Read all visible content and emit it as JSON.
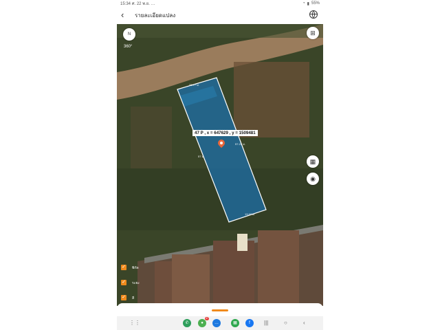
{
  "status": {
    "time": "15:34",
    "date": "ศ. 22 พ.ย.",
    "indicators": "…",
    "battery": "55%"
  },
  "header": {
    "title": "รายละเอียดแปลง"
  },
  "map": {
    "btn_360_label": "360°",
    "compass_symbol": "N",
    "parcel_label": "47 P , x = 647629 , y = 1509481",
    "dimensions": [
      "23.77 ม.",
      "57.23 ม.",
      "57 ม.",
      "13.97 ม."
    ],
    "layers": [
      {
        "label": "พิกัด",
        "checked": true
      },
      {
        "label": "ระยะ",
        "checked": true
      },
      {
        "label": "สี",
        "checked": true
      }
    ],
    "parcel_color": "#1e6fa8",
    "accent_color": "#f08a1c"
  },
  "nav": {
    "apps": [
      {
        "name": "phone-app",
        "color": "#2e9e5b"
      },
      {
        "name": "messages-app",
        "color": "#4caf50",
        "badge": "47"
      },
      {
        "name": "chat-app",
        "color": "#1f7ae0"
      },
      {
        "name": "apps-grid-app",
        "color": "#2fa84f"
      },
      {
        "name": "facebook-app",
        "color": "#1877f2"
      }
    ]
  }
}
